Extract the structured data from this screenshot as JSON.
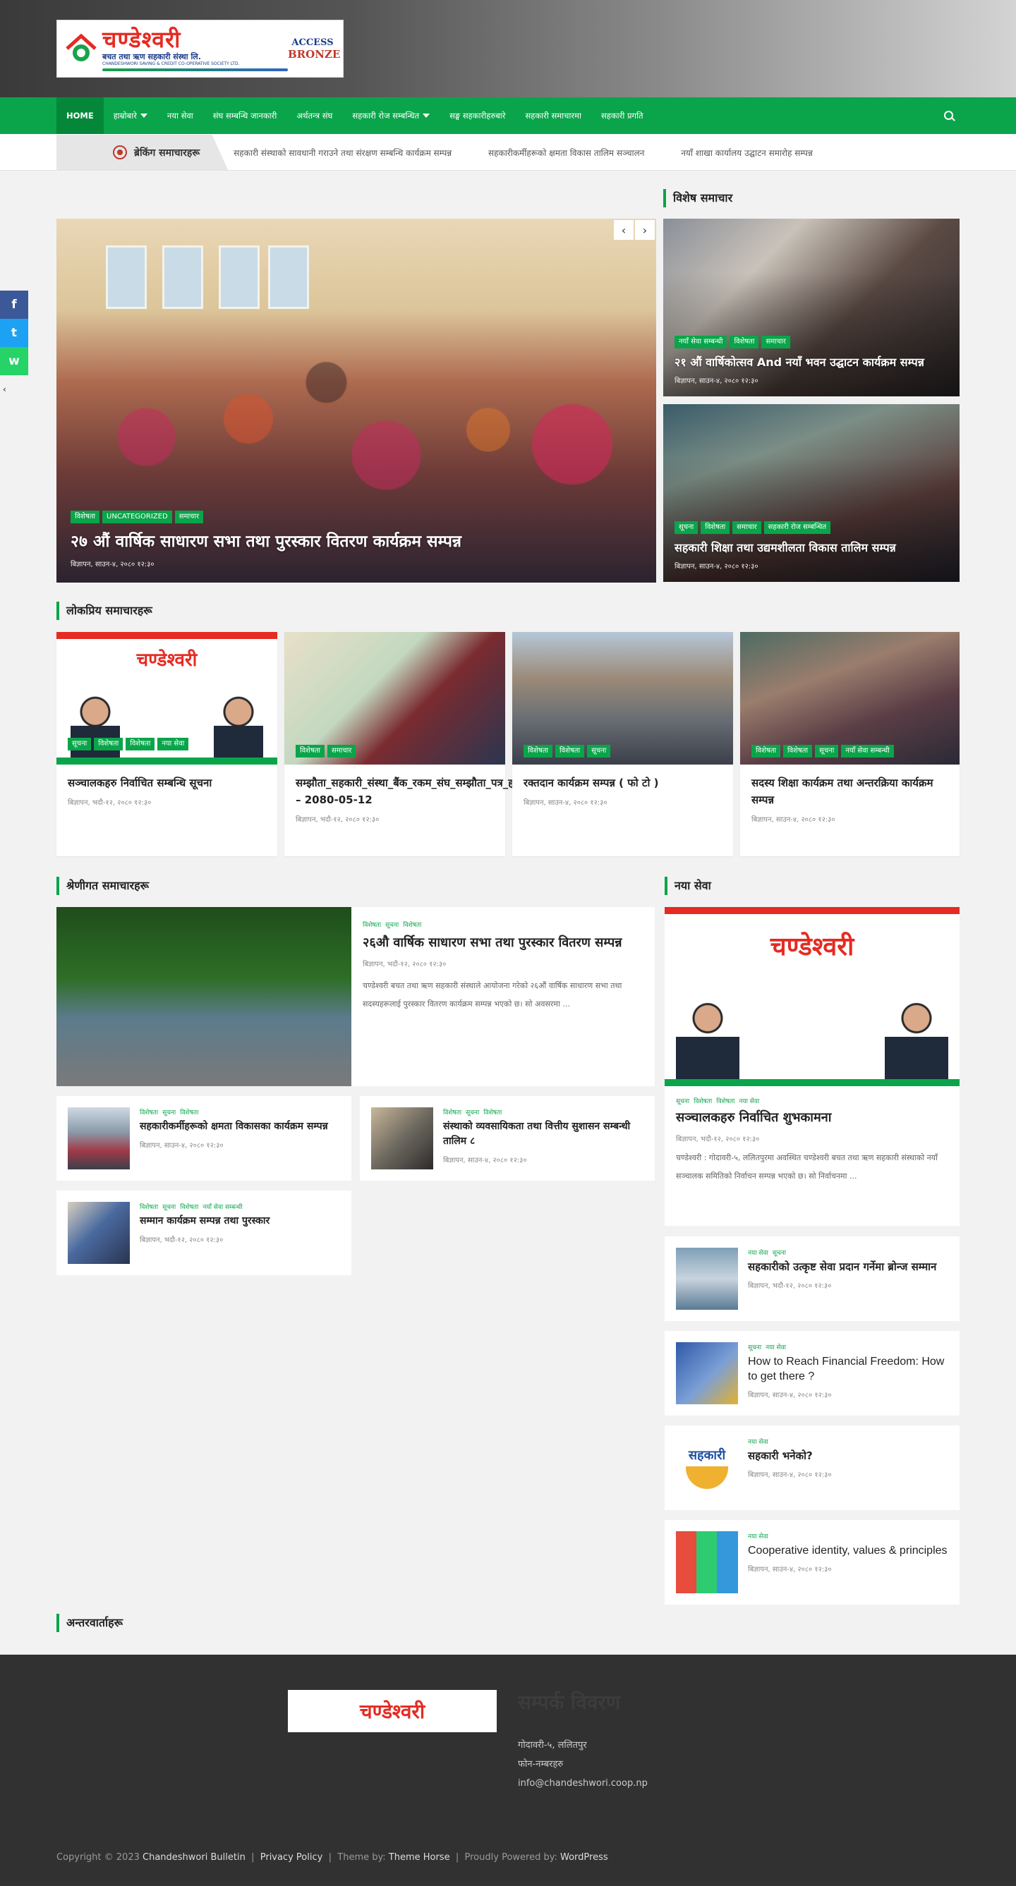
{
  "site": {
    "logo_text": "चण्डेश्वरी",
    "logo_sub": "बचत तथा ऋण सहकारी संस्था लि.",
    "logo_eng": "CHANDESHWORI SAVING & CREDIT CO-OPERATIVE SOCIETY LTD.",
    "badge_top": "ACCESS",
    "badge_bottom": "BRONZE"
  },
  "nav": {
    "items": [
      "HOME",
      "हाम्रोबारे",
      "नया सेवा",
      "संघ सम्बन्धि जानकारी",
      "अर्थतन्त्र संघ",
      "सहकारी रोज सम्बन्धित",
      "सङ्घ सहकारीहरुबारे",
      "सहकारी समाचारमा",
      "सहकारी प्रगति"
    ]
  },
  "ticker": {
    "label": "ब्रेकिंग समाचारहरू",
    "items": [
      "सहकारी संस्थाको सावधानी गराउने तथा संरक्षण सम्बन्धि कार्यक्रम सम्पन्न",
      "सहकारीकर्मीहरूको क्षमता विकास तालिम सञ्चालन",
      "नयाँ शाखा कार्यालय उद्घाटन समारोह सम्पन्न"
    ]
  },
  "slider": {
    "tags": [
      "विशेषता",
      "UNCATEGORIZED",
      "समाचार"
    ],
    "title": "२७ औं वार्षिक साधारण सभा तथा पुरस्कार वितरण कार्यक्रम सम्पन्न",
    "meta": "बिज्ञापन, साउन-४, २०८० १२:३०"
  },
  "featured_head": "विशेष समाचार",
  "featured": [
    {
      "tags": [
        "नयाँ सेवा सम्बन्धी",
        "विशेषता",
        "समाचार"
      ],
      "title": "२१ औं वार्षिकोत्सव And नयाँ भवन उद्घाटन कार्यक्रम सम्पन्न",
      "meta": "बिज्ञापन, साउन-४, २०८० १२:३०"
    },
    {
      "tags": [
        "सूचना",
        "विशेषता",
        "समाचार",
        "सहकारी रोज सम्बन्धित"
      ],
      "title": "सहकारी शिक्षा तथा उद्यमशीलता विकास तालिम सम्पन्न",
      "meta": "बिज्ञापन, साउन-४, २०८० १२:३०"
    }
  ],
  "popular_head": "लोकप्रिय समाचारहरू",
  "popular": [
    {
      "tags": [
        "सूचना",
        "विशेषता",
        "विशेषता",
        "नया सेवा"
      ],
      "title": "सञ्चालकहरु निर्वाचित सम्बन्धि सूचना",
      "meta": "बिज्ञापन, भदौ-१२, २०८० १२:३०"
    },
    {
      "tags": [
        "विशेषता",
        "समाचार"
      ],
      "title": "सम्झौता_सहकारी_संस्था_बैंक_रकम_संघ_सम्झौता_पत्र_हस्तान्तरण – 2080-05-12",
      "meta": "बिज्ञापन, भदौ-१२, २०८० १२:३०"
    },
    {
      "tags": [
        "विशेषता",
        "विशेषता",
        "सूचना"
      ],
      "title": "रक्तदान कार्यक्रम सम्पन्न ( फो टो )",
      "meta": "बिज्ञापन, साउन-४, २०८० १२:३०"
    },
    {
      "tags": [
        "विशेषता",
        "विशेषता",
        "सूचना",
        "नयाँ सेवा सम्बन्धी"
      ],
      "title": "सदस्य शिक्षा कार्यक्रम तथा अन्तरक्रिया कार्यक्रम सम्पन्न",
      "meta": "बिज्ञापन, साउन-४, २०८० १२:३०"
    }
  ],
  "category_head": "श्रेणीगत समाचारहरू",
  "category_main": {
    "tags": [
      "विशेषता",
      "सूचना",
      "विशेषता"
    ],
    "title": "२६औ वार्षिक साधारण सभा तथा पुरस्कार वितरण सम्पन्न",
    "meta": "बिज्ञापन, भदौ-१२, २०८० १२:३०",
    "excerpt": "चण्डेश्वरी बचत तथा ऋण सहकारी संस्थाले आयोजना गरेको २६औं वार्षिक साधारण सभा तथा सदस्यहरूलाई पुरस्कार वितरण कार्यक्रम सम्पन्न भएको छ। सो अवसरमा ..."
  },
  "category_small": [
    {
      "tags": [
        "विशेषता",
        "सूचना",
        "विशेषता"
      ],
      "title": "सहकारीकर्मीहरूको क्षमता विकासका कार्यक्रम सम्पन्न",
      "meta": "बिज्ञापन, साउन-४, २०८० १२:३०"
    },
    {
      "tags": [
        "विशेषता",
        "सूचना",
        "विशेषता"
      ],
      "title": "संस्थाको व्यवसायिकता तथा वित्तीय सुशासन सम्बन्धी तालिम ८",
      "meta": "बिज्ञापन, साउन-४, २०८० १२:३०"
    },
    {
      "tags": [
        "विशेषता",
        "सूचना",
        "विशेषता",
        "नयाँ सेवा सम्बन्धी"
      ],
      "title": "सम्मान कार्यक्रम सम्पन्न तथा पुरस्कार",
      "meta": "बिज्ञापन, भदौ-१२, २०८० १२:३०"
    }
  ],
  "sidebar_head": "नया सेवा",
  "sidebar_main": {
    "tags": [
      "सूचना",
      "विशेषता",
      "विशेषता",
      "नया सेवा"
    ],
    "title": "सञ्चालकहरु निर्वाचित शुभकामना",
    "meta": "बिज्ञापन, भदौ-१२, २०८० १२:३०",
    "excerpt": "चण्डेश्वरी : गोदावरी-५, ललितपुरमा अवस्थित चण्डेश्वरी बचत तथा ऋण सहकारी संस्थाको नयाँ सञ्चालक समितिको निर्वाचन सम्पन्न भएको छ। सो निर्वाचनमा ..."
  },
  "sidebar_list": [
    {
      "tags": [
        "नया सेवा",
        "सूचना"
      ],
      "title": "सहकारीको उत्कृष्ट सेवा प्रदान गर्नेमा ब्रोन्ज सम्मान",
      "meta": "बिज्ञापन, भदौ-१२, २०८० १२:३०"
    },
    {
      "tags": [
        "सूचना",
        "नया सेवा"
      ],
      "title": "How to Reach Financial Freedom: How to get there ?",
      "meta": "बिज्ञापन, साउन-४, २०८० १२:३०"
    },
    {
      "tags": [
        "नया सेवा"
      ],
      "title": "सहकारी भनेको?",
      "meta": "बिज्ञापन, साउन-४, २०८० १२:३०"
    },
    {
      "tags": [
        "नया सेवा"
      ],
      "title": "Cooperative identity, values & principles",
      "meta": "बिज्ञापन, साउन-४, २०८० १२:३०"
    }
  ],
  "sidebar_icon_text": "सहकारी",
  "more_head": "अन्तरवार्ताहरू",
  "footer": {
    "logo": "चण्डेश्वरी",
    "heading": "सम्पर्क विवरण",
    "address": "गोदावरी-५, ललितपुर",
    "phone": "फोन-नम्बरहरु",
    "email": "info@chandeshwori.coop.np",
    "copyright": "Copyright © 2023",
    "site_name": "Chandeshwori Bulletin",
    "privacy": "Privacy Policy",
    "theme_by": "Theme by:",
    "theme_name": "Theme Horse",
    "powered": "Proudly Powered by:",
    "wp": "WordPress"
  },
  "colors": {
    "accent": "#0aa54a",
    "logo_red": "#e52b22"
  }
}
